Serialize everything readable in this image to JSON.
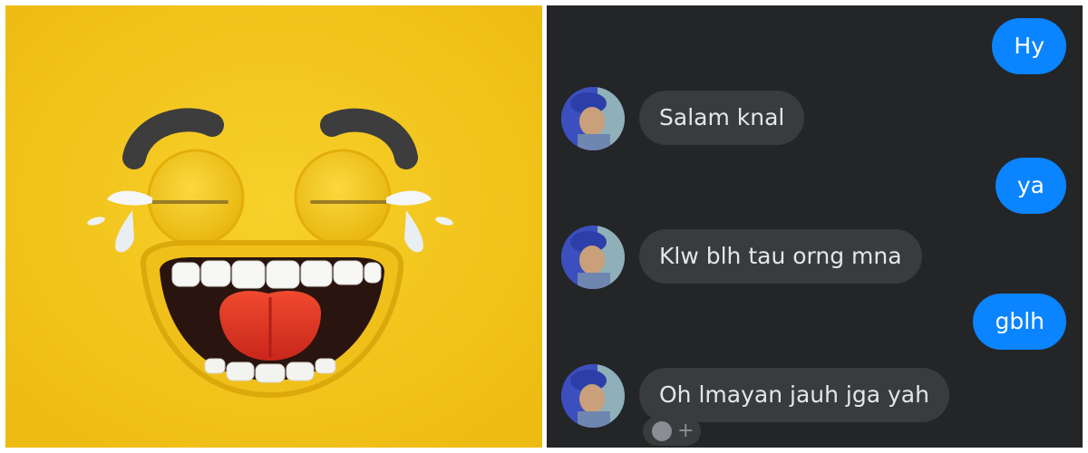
{
  "emoji": {
    "icon": "laughing-crying-face-icon",
    "background_color": "#f3c51d"
  },
  "chat": {
    "background_color": "#242526",
    "outgoing_color": "#0a84ff",
    "incoming_color": "#3a3b3c",
    "messages": [
      {
        "direction": "outgoing",
        "text": "Hy"
      },
      {
        "direction": "incoming",
        "text": "Salam knal"
      },
      {
        "direction": "outgoing",
        "text": "ya"
      },
      {
        "direction": "incoming",
        "text": "Klw blh tau orng mna"
      },
      {
        "direction": "outgoing",
        "text": "gblh"
      },
      {
        "direction": "incoming",
        "text": "Oh lmayan jauh jga yah"
      }
    ],
    "reaction_button": {
      "icon": "smiley-icon",
      "plus_icon": "plus-icon"
    }
  }
}
